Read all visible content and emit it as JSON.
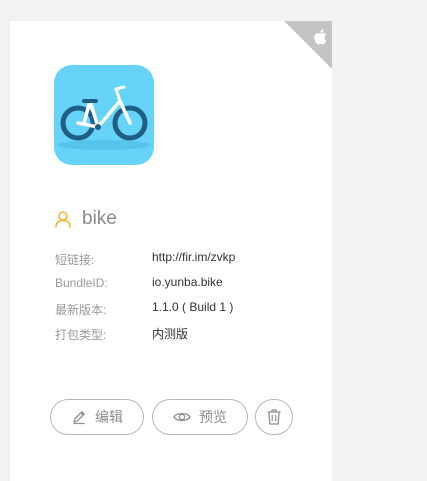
{
  "app": {
    "name": "bike",
    "platform_icon": "apple-icon",
    "icon": "bicycle-icon"
  },
  "info": [
    {
      "label": "短链接:",
      "value": "http://fir.im/zvkp"
    },
    {
      "label": "BundleID:",
      "value": "io.yunba.bike"
    },
    {
      "label": "最新版本:",
      "value": "1.1.0 ( Build 1 )"
    },
    {
      "label": "打包类型:",
      "value": "内测版"
    }
  ],
  "actions": {
    "edit_label": "编辑",
    "edit_icon": "pencil-icon",
    "preview_label": "预览",
    "preview_icon": "eye-icon",
    "delete_icon": "trash-icon"
  },
  "colors": {
    "icon_background": "#66d3f8",
    "user_icon": "#f3b532",
    "corner": "#c4c4c4"
  }
}
